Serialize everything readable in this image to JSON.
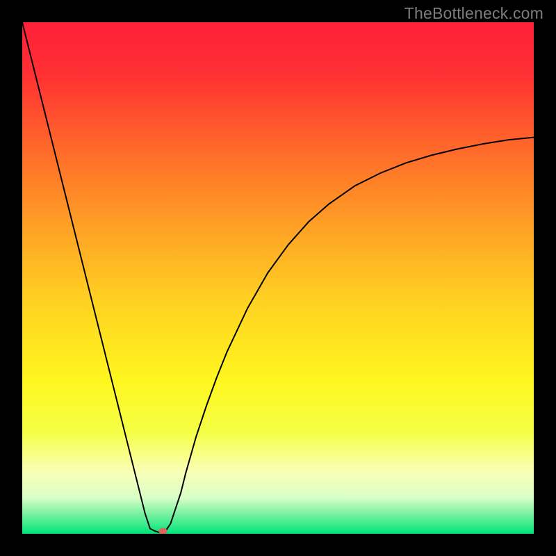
{
  "watermark": "TheBottleneck.com",
  "chart_data": {
    "type": "line",
    "title": "",
    "xlabel": "",
    "ylabel": "",
    "xlim": [
      0,
      100
    ],
    "ylim": [
      0,
      100
    ],
    "background_gradient": {
      "stops": [
        {
          "offset": 0.0,
          "color": "#ff1f3a"
        },
        {
          "offset": 0.1,
          "color": "#ff3033"
        },
        {
          "offset": 0.25,
          "color": "#ff6a2a"
        },
        {
          "offset": 0.4,
          "color": "#ffa125"
        },
        {
          "offset": 0.55,
          "color": "#ffd321"
        },
        {
          "offset": 0.7,
          "color": "#fff61f"
        },
        {
          "offset": 0.8,
          "color": "#f5ff45"
        },
        {
          "offset": 0.88,
          "color": "#f9ffb8"
        },
        {
          "offset": 0.93,
          "color": "#d7ffc6"
        },
        {
          "offset": 0.965,
          "color": "#6df09c"
        },
        {
          "offset": 1.0,
          "color": "#00e47a"
        }
      ]
    },
    "series": [
      {
        "name": "bottleneck-curve",
        "color": "#000000",
        "stroke_width": 2,
        "x": [
          0,
          2,
          4,
          6,
          8,
          10,
          12,
          14,
          16,
          18,
          20,
          22,
          24,
          25,
          26,
          27,
          27.5,
          28,
          29,
          30,
          31,
          32,
          34,
          36,
          38,
          40,
          44,
          48,
          52,
          56,
          60,
          65,
          70,
          75,
          80,
          85,
          90,
          95,
          100
        ],
        "y": [
          100,
          92,
          84,
          76,
          68,
          60,
          52,
          44,
          36,
          28,
          20,
          12,
          4,
          1,
          0.5,
          0.2,
          0.2,
          0.5,
          2,
          5,
          8,
          12,
          19,
          25,
          30.5,
          35.5,
          44,
          51,
          56.5,
          61,
          64.5,
          68,
          70.5,
          72.5,
          74,
          75.2,
          76.2,
          77,
          77.5
        ]
      }
    ],
    "marker": {
      "name": "optimum-point",
      "x": 27.5,
      "y": 0.5,
      "color": "#d46a5e",
      "rx": 6,
      "ry": 5
    }
  }
}
